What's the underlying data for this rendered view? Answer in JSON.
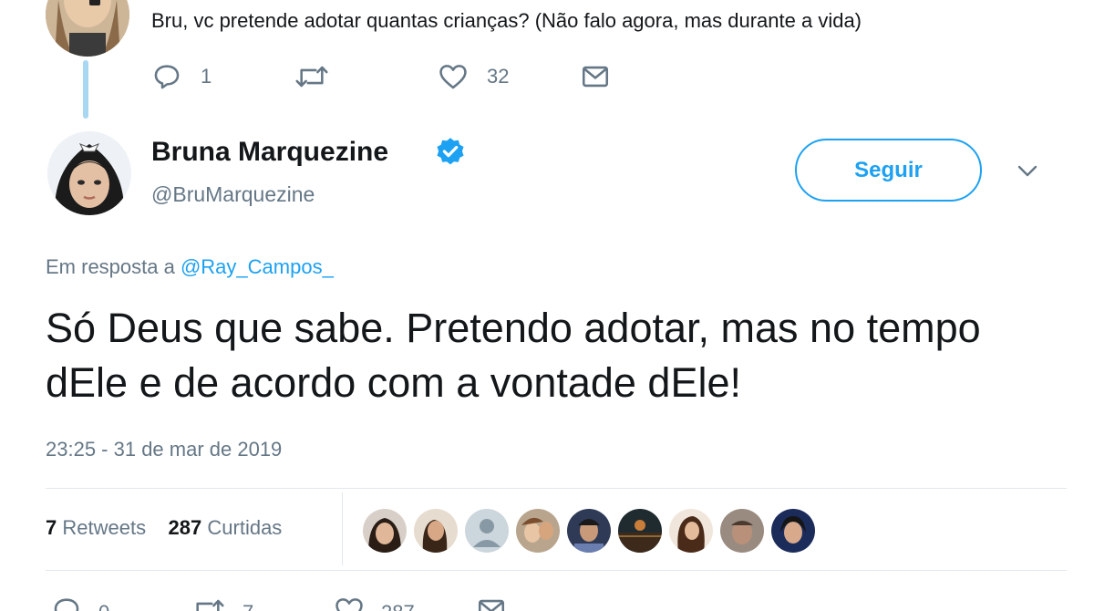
{
  "parent_tweet": {
    "text": "Bru, vc pretende adotar quantas crianças? (Não falo agora, mas durante a vida)",
    "reply_count": "1",
    "like_count": "32"
  },
  "tweet": {
    "author_name": "Bruna Marquezine",
    "author_handle": "@BruMarquezine",
    "follow_label": "Seguir",
    "reply_prefix": "Em resposta a ",
    "reply_mention": "@Ray_Campos_",
    "body": "Só Deus que sabe. Pretendo adotar, mas no tempo dEle e de acordo com a vontade dEle!",
    "timestamp": "23:25 - 31 de mar de 2019",
    "retweet_count": "7",
    "retweet_label": "Retweets",
    "like_count": "287",
    "like_label": "Curtidas"
  },
  "bottom_actions": {
    "reply_count": "0",
    "retweet_count": "7",
    "like_count": "287"
  },
  "colors": {
    "accent": "#1da1f2",
    "muted": "#657786",
    "text": "#14171a",
    "thread_line": "#a8d7f2"
  },
  "icons": [
    "reply-icon",
    "retweet-icon",
    "like-icon",
    "dm-icon",
    "verified-icon",
    "chevron-down-icon"
  ]
}
